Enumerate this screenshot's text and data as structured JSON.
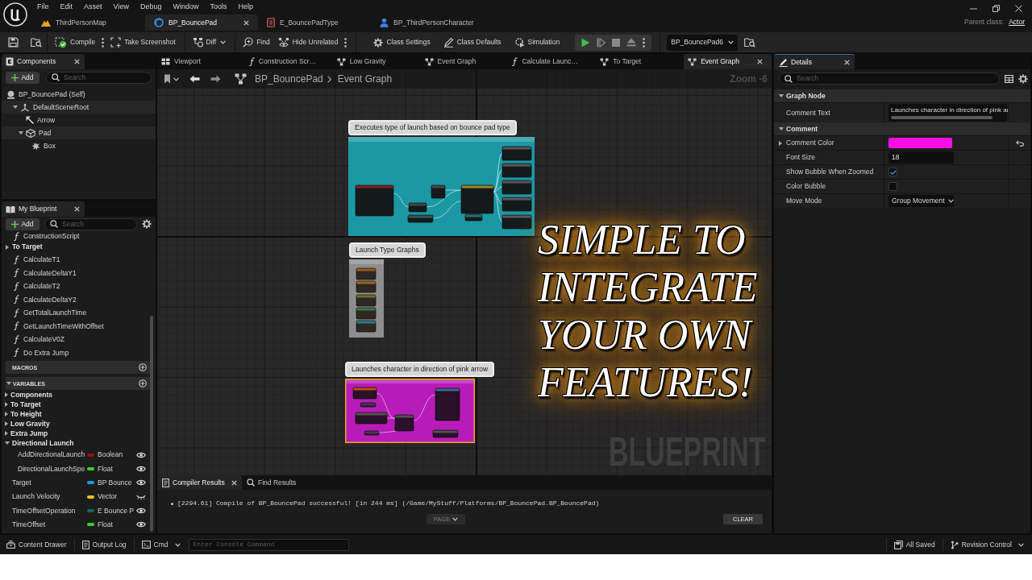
{
  "menu_bar": [
    "File",
    "Edit",
    "Asset",
    "View",
    "Debug",
    "Window",
    "Tools",
    "Help"
  ],
  "asset_tabs": [
    {
      "label": "ThirdPersonMap",
      "kind": "level",
      "selected": false
    },
    {
      "label": "BP_BouncePad",
      "kind": "blueprint",
      "selected": true
    },
    {
      "label": "E_BouncePadType",
      "kind": "enum",
      "selected": false
    },
    {
      "label": "BP_ThirdPersonCharacter",
      "kind": "character",
      "selected": false
    }
  ],
  "parent_class": {
    "label": "Parent class:",
    "value": "Actor"
  },
  "toolbar": {
    "buttons": [
      {
        "label": "Compile",
        "kind": "split"
      },
      {
        "label": "Take Screenshot",
        "kind": "plain"
      },
      {
        "label": "Diff",
        "kind": "dropdown"
      },
      {
        "label": "Find",
        "kind": "plain"
      },
      {
        "label": "Hide Unrelated",
        "kind": "split"
      },
      {
        "label": "Class Settings",
        "kind": "plain"
      },
      {
        "label": "Class Defaults",
        "kind": "plain"
      },
      {
        "label": "Simulation",
        "kind": "plain"
      }
    ],
    "debug_object": "BP_BouncePad6"
  },
  "components_panel": {
    "title": "Components",
    "add_label": "Add",
    "search_placeholder": "Search",
    "self_label": "BP_BouncePad (Self)",
    "tree": [
      {
        "label": "DefaultSceneRoot",
        "kind": "scene",
        "expanded": true,
        "children": [
          {
            "label": "Arrow",
            "kind": "arrow"
          },
          {
            "label": "Pad",
            "kind": "mesh",
            "expanded": true,
            "children": [
              {
                "label": "Box",
                "kind": "collision"
              }
            ]
          }
        ]
      }
    ]
  },
  "my_blueprint_panel": {
    "title": "My Blueprint",
    "add_label": "Add",
    "search_placeholder": "Search",
    "functions": [
      {
        "kind": "function",
        "label": "ConstructionScript"
      },
      {
        "kind": "category",
        "label": "To Target",
        "expanded": false
      },
      {
        "kind": "function",
        "label": "CalculateT1"
      },
      {
        "kind": "function",
        "label": "CalculateDeltaY1"
      },
      {
        "kind": "function",
        "label": "CalculateT2"
      },
      {
        "kind": "function",
        "label": "CalculateDeltaY2"
      },
      {
        "kind": "function",
        "label": "GetTotalLaunchTime"
      },
      {
        "kind": "function",
        "label": "GetLaunchTimeWithOffset"
      },
      {
        "kind": "function",
        "label": "CalculateV0Z"
      },
      {
        "kind": "function",
        "label": "Do Extra Jump"
      }
    ],
    "macros": {
      "title": "MACROS"
    },
    "variables": {
      "title": "VARIABLES",
      "expanded": true,
      "items": [
        {
          "kind": "category",
          "label": "Components",
          "expanded": false
        },
        {
          "kind": "category",
          "label": "To Target",
          "expanded": false
        },
        {
          "kind": "category",
          "label": "To Height",
          "expanded": false
        },
        {
          "kind": "category",
          "label": "Low Gravity",
          "expanded": false
        },
        {
          "kind": "category",
          "label": "Extra Jump",
          "expanded": false
        },
        {
          "kind": "category",
          "label": "Directional Launch",
          "expanded": true,
          "children": [
            {
              "kind": "variable",
              "name": "AddDirectionalLaunch",
              "type": "Boolean",
              "color": "#9e0d0d",
              "exposed": true
            },
            {
              "kind": "variable",
              "name": "DirectionalLaunchSpe",
              "type": "Float",
              "color": "#35d02a",
              "exposed": true
            }
          ]
        },
        {
          "kind": "variable",
          "name": "Target",
          "type": "BP Bounce",
          "color": "#1c9be8",
          "exposed": true
        },
        {
          "kind": "variable",
          "name": "Launch Velocity",
          "type": "Vector",
          "color": "#f7c51c",
          "exposed": false
        },
        {
          "kind": "variable",
          "name": "TimeOffsetOperation",
          "type": "E Bounce P",
          "color": "#0a6b62",
          "exposed": true
        },
        {
          "kind": "variable",
          "name": "TimeOffset",
          "type": "Float",
          "color": "#35d02a",
          "exposed": true
        }
      ]
    }
  },
  "graph_tabs": [
    {
      "label": "Viewport",
      "kind": "viewport",
      "selected": false
    },
    {
      "label": "Construction Scr…",
      "kind": "function",
      "selected": false
    },
    {
      "label": "Low Gravity",
      "kind": "graph",
      "selected": false
    },
    {
      "label": "Event Graph",
      "kind": "graph",
      "selected": false
    },
    {
      "label": "Calculate Launc…",
      "kind": "function",
      "selected": false
    },
    {
      "label": "To Target",
      "kind": "graph",
      "selected": false
    },
    {
      "label": "Event Graph",
      "kind": "graph",
      "selected": true
    }
  ],
  "breadcrumb": [
    "BP_BouncePad",
    "Event Graph"
  ],
  "zoom_label": "Zoom -6",
  "comments": [
    {
      "title": "Executes type of launch based on bounce pad type",
      "color": "#1b98a4",
      "selected": false
    },
    {
      "title": "Launch Type Graphs",
      "color": "#8e8e8e",
      "selected": false
    },
    {
      "title": "Launches character in direction of pink arrow",
      "color": "#b81cb8",
      "selected": true
    }
  ],
  "promo_caption": [
    "SIMPLE TO",
    "INTEGRATE",
    "YOUR OWN",
    "FEATURES!"
  ],
  "graph_type_label": "BLUEPRINT",
  "results_panel": {
    "tabs": [
      {
        "label": "Compiler Results",
        "selected": true
      },
      {
        "label": "Find Results",
        "selected": false
      }
    ],
    "messages": [
      "[2294.61] Compile of BP_BouncePad successful! [in 244 ms] (/Game/MyStuff/Platforms/BP_BouncePad.BP_BouncePad)"
    ],
    "page_button": {
      "label": "PAGE",
      "disabled": true
    },
    "clear_label": "CLEAR"
  },
  "details_panel": {
    "title": "Details",
    "search_placeholder": "Search",
    "sections": [
      {
        "title": "Graph Node",
        "expanded": true,
        "rows": [
          {
            "label": "Comment Text",
            "kind": "multiline",
            "value": "Launches character in direction of pink ar",
            "modified": false
          }
        ]
      },
      {
        "title": "Comment",
        "expanded": true,
        "rows": [
          {
            "label": "Comment Color",
            "kind": "color",
            "color": "#ff0fe6",
            "expanded": false,
            "modified": true
          },
          {
            "label": "Font Size",
            "kind": "number",
            "value": "18",
            "modified": false
          },
          {
            "label": "Show Bubble When Zoomed",
            "kind": "checkbox",
            "checked": true,
            "modified": false
          },
          {
            "label": "Color Bubble",
            "kind": "checkbox",
            "checked": false,
            "modified": false
          },
          {
            "label": "Move Mode",
            "kind": "dropdown",
            "value": "Group Movement",
            "modified": false
          }
        ]
      }
    ]
  },
  "status_bar": {
    "content_drawer": "Content Drawer",
    "output_log": "Output Log",
    "cmd": "Cmd",
    "console_placeholder": "Enter Console Command",
    "save_state": "All Saved",
    "revision_control": "Revision Control"
  }
}
